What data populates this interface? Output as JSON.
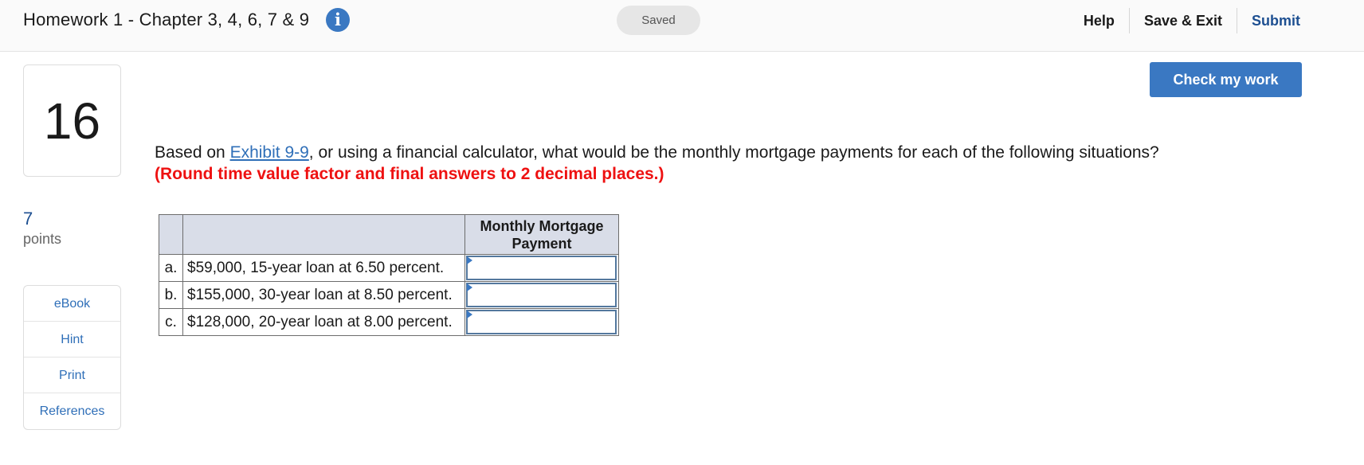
{
  "header": {
    "assignment_title": "Homework 1 - Chapter 3, 4, 6, 7 & 9",
    "info_icon_glyph": "i",
    "saved_status": "Saved",
    "nav": {
      "help": "Help",
      "save_exit": "Save & Exit",
      "submit": "Submit"
    }
  },
  "question": {
    "number": "16",
    "points_value": "7",
    "points_label": "points",
    "text_before": "Based on ",
    "exhibit_link": "Exhibit 9-9",
    "text_after": ", or using a financial calculator, what would be the monthly mortgage payments for each of the following situations? ",
    "instruction": "(Round time value factor and final answers to 2 decimal places.)"
  },
  "resources": {
    "ebook": "eBook",
    "hint": "Hint",
    "print": "Print",
    "references": "References"
  },
  "actions": {
    "check_my_work": "Check my work"
  },
  "table": {
    "header": {
      "letter": "",
      "description": "",
      "payment": "Monthly Mortgage Payment"
    },
    "rows": [
      {
        "letter": "a.",
        "description": "$59,000, 15-year loan at 6.50 percent.",
        "value": ""
      },
      {
        "letter": "b.",
        "description": "$155,000, 30-year loan at 8.50 percent.",
        "value": ""
      },
      {
        "letter": "c.",
        "description": "$128,000, 20-year loan at 8.00 percent.",
        "value": ""
      }
    ]
  },
  "colors": {
    "accent": "#3a78c2",
    "instruction": "#ee1111",
    "link": "#2f6fb8",
    "table_header_bg": "#d9dde8"
  },
  "icons": {
    "info": "info-icon"
  }
}
